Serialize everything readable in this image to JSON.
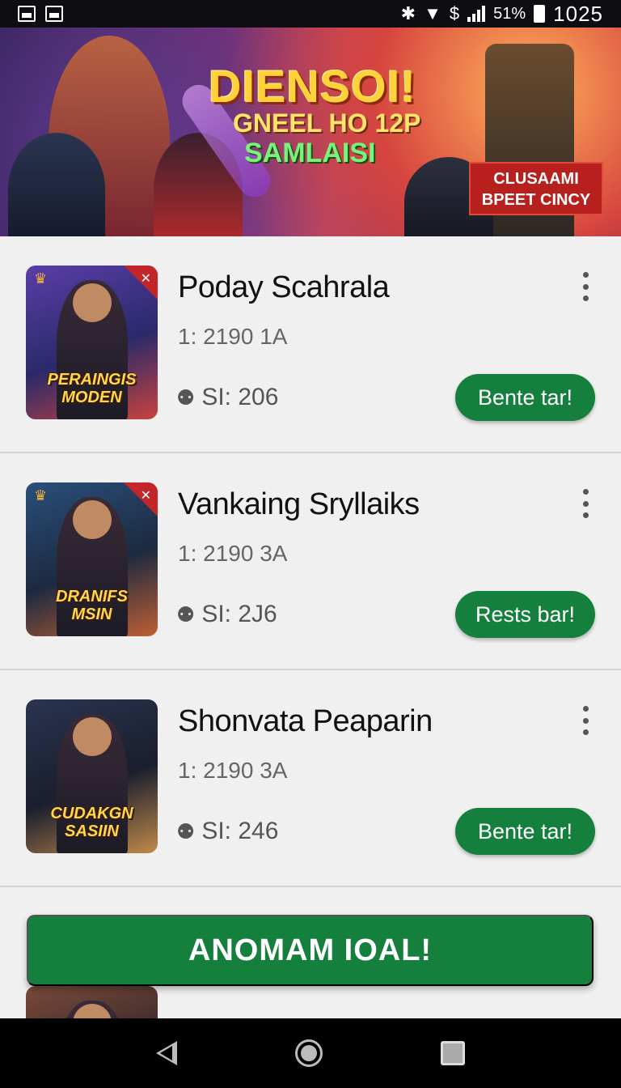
{
  "status_bar": {
    "battery_pct": "51%",
    "time": "1025",
    "signal_label": "$"
  },
  "banner": {
    "title": "DIENSOI!",
    "subtitle_line1": "GNEEL HO 12P",
    "subtitle_line2": "SAMLAISI",
    "badge_line1": "CLUSAAMI",
    "badge_line2": "BPEET CINCY"
  },
  "items": [
    {
      "title": "Poday Scahrala",
      "meta": "1: 2190 1A",
      "price": "SI: 206",
      "cta": "Bente tar!",
      "thumb_tag_line1": "PERAINGIS",
      "thumb_tag_line2": "MODEN",
      "thumb_colors": [
        "#5a3ea8",
        "#c8433e"
      ]
    },
    {
      "title": "Vankaing Sryllaiks",
      "meta": "1: 2190 3A",
      "price": "SI: 2J6",
      "cta": "Rests bar!",
      "thumb_tag_line1": "DRANIFS",
      "thumb_tag_line2": "MSIN",
      "thumb_colors": [
        "#2a4f7a",
        "#c05f34"
      ]
    },
    {
      "title": "Shonvata Peaparin",
      "meta": "1: 2190 3A",
      "price": "SI: 246",
      "cta": "Bente tar!",
      "thumb_tag_line1": "CUDAKGN",
      "thumb_tag_line2": "SASIIN",
      "thumb_colors": [
        "#2a3450",
        "#c08a4a"
      ]
    }
  ],
  "bottom_cta": "ANOMAM IOAL!",
  "colors": {
    "primary_green": "#15803d",
    "badge_red": "#b8201e"
  },
  "icons": [
    "bluetooth-icon",
    "wifi-icon",
    "signal-icon",
    "battery-icon",
    "more-vert-icon",
    "location-pin-icon",
    "back-icon",
    "home-icon",
    "recents-icon"
  ]
}
